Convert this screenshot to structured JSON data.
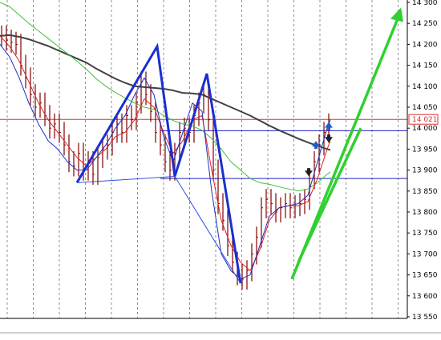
{
  "chart_data": {
    "type": "line",
    "title": "",
    "xlabel": "",
    "ylabel": "",
    "ylim": [
      13550,
      14300
    ],
    "y_ticks": [
      13550,
      13600,
      13650,
      13700,
      13750,
      13800,
      13850,
      13900,
      13950,
      14000,
      14050,
      14100,
      14150,
      14200,
      14250,
      14300
    ],
    "y_tick_labels": [
      "13 550",
      "13 600",
      "13 650",
      "13 700",
      "13 750",
      "13 800",
      "13 850",
      "13 900",
      "13 950",
      "14 000",
      "14 050",
      "14 100",
      "14 150",
      "14 200",
      "14 250",
      "14 300"
    ],
    "grid": {
      "vertical": true,
      "horizontal": false
    },
    "current_price": {
      "value": 14021,
      "label": "14 021",
      "color": "#e03030"
    },
    "horizontal_levels": [
      {
        "value": 14021,
        "color": "#e03030"
      },
      {
        "value": 13994,
        "color": "#2020c0"
      },
      {
        "value": 13880,
        "color": "#2020c0"
      }
    ],
    "series": [
      {
        "color": "#404040",
        "x": [
          0,
          12,
          24,
          36,
          48,
          60,
          72,
          84,
          96,
          108,
          120,
          132,
          144,
          156,
          168,
          180,
          192,
          204,
          216,
          228,
          240,
          252,
          264,
          276,
          288,
          300,
          312,
          324,
          336,
          348,
          360,
          372,
          384,
          396,
          408,
          412
        ],
        "values": [
          14220,
          14222,
          14218,
          14212,
          14204,
          14196,
          14186,
          14176,
          14166,
          14156,
          14142,
          14130,
          14118,
          14108,
          14100,
          14098,
          14096,
          14094,
          14090,
          14084,
          14083,
          14080,
          14070,
          14060,
          14050,
          14040,
          14030,
          14018,
          14006,
          13995,
          13985,
          13975,
          13966,
          13958,
          13950,
          13948
        ]
      },
      {
        "color": "#40c040",
        "x": [
          0,
          12,
          24,
          36,
          48,
          60,
          72,
          84,
          96,
          108,
          120,
          132,
          144,
          156,
          168,
          180,
          192,
          204,
          216,
          228,
          240,
          252,
          264,
          276,
          288,
          300,
          312,
          324,
          336,
          348,
          360,
          372,
          384,
          396,
          408,
          412
        ],
        "values": [
          14300,
          14290,
          14270,
          14250,
          14232,
          14214,
          14196,
          14178,
          14160,
          14140,
          14118,
          14100,
          14085,
          14072,
          14060,
          14050,
          14045,
          14030,
          14018,
          14010,
          14005,
          13995,
          13975,
          13950,
          13920,
          13900,
          13880,
          13870,
          13866,
          13860,
          13855,
          13850,
          13855,
          13870,
          13890,
          13895
        ]
      },
      {
        "color": "#e02020",
        "x": [
          0,
          12,
          24,
          36,
          48,
          60,
          72,
          84,
          96,
          108,
          120,
          132,
          144,
          156,
          168,
          180,
          192,
          204,
          216,
          228,
          240,
          252,
          264,
          276,
          288,
          300,
          312,
          324,
          336,
          348,
          360,
          372,
          384,
          396,
          408,
          412
        ],
        "values": [
          14220,
          14195,
          14160,
          14110,
          14060,
          14020,
          13990,
          13960,
          13930,
          13910,
          13930,
          13950,
          13980,
          13990,
          14020,
          14070,
          14050,
          13990,
          13940,
          13970,
          14020,
          14030,
          13900,
          13780,
          13720,
          13680,
          13660,
          13710,
          13780,
          13810,
          13815,
          13815,
          13825,
          13880,
          13950,
          13970
        ]
      },
      {
        "color": "#2030c0",
        "x": [
          0,
          12,
          24,
          36,
          48,
          60,
          72,
          84,
          96,
          108,
          120,
          132,
          144,
          156,
          168,
          180,
          192,
          204,
          216,
          228,
          240,
          252,
          264,
          276,
          288,
          300,
          312,
          324,
          336,
          348,
          360,
          372,
          384,
          396,
          408,
          412
        ],
        "values": [
          14200,
          14170,
          14120,
          14060,
          14010,
          13970,
          13950,
          13920,
          13900,
          13900,
          13930,
          13960,
          14000,
          14030,
          14080,
          14120,
          14080,
          13980,
          13920,
          13990,
          14060,
          14040,
          13850,
          13700,
          13660,
          13640,
          13650,
          13720,
          13790,
          13810,
          13815,
          13820,
          13840,
          13920,
          14000,
          14020
        ]
      }
    ],
    "price_bars": {
      "color": "#800000",
      "x": [
        0,
        6,
        12,
        18,
        24,
        30,
        36,
        42,
        48,
        54,
        60,
        66,
        72,
        78,
        84,
        90,
        96,
        102,
        108,
        114,
        120,
        126,
        132,
        138,
        144,
        150,
        156,
        162,
        168,
        174,
        180,
        186,
        192,
        198,
        204,
        210,
        216,
        222,
        228,
        234,
        240,
        246,
        252,
        258,
        264,
        270,
        276,
        282,
        288,
        294,
        300,
        306,
        312,
        318,
        324,
        330,
        336,
        342,
        348,
        354,
        360,
        366,
        372,
        378,
        384,
        390,
        396,
        402,
        408
      ],
      "values": [
        14220,
        14210,
        14205,
        14200,
        14150,
        14120,
        14080,
        14050,
        14060,
        14030,
        14000,
        14010,
        13990,
        13960,
        13920,
        13910,
        13940,
        13900,
        13920,
        13890,
        13930,
        13950,
        13960,
        13990,
        14010,
        13990,
        14030,
        14020,
        14060,
        14110,
        14080,
        14040,
        13990,
        13960,
        13920,
        13900,
        13940,
        13990,
        14000,
        13990,
        14030,
        14060,
        14080,
        14020,
        13900,
        13820,
        13780,
        13720,
        13680,
        13650,
        13640,
        13660,
        13700,
        13740,
        13810,
        13830,
        13820,
        13800,
        13810,
        13820,
        13810,
        13815,
        13820,
        13830,
        13880,
        13920,
        13960,
        13990,
        14010
      ]
    },
    "drawn_lines": [
      {
        "color": "#1a2fd0",
        "points": [
          [
            96,
            13870
          ],
          [
            196,
            14195
          ],
          [
            218,
            13885
          ],
          [
            258,
            14130
          ],
          [
            300,
            13630
          ]
        ]
      },
      {
        "color": "#3050e0",
        "thin": true,
        "points": [
          [
            96,
            13870
          ],
          [
            218,
            13885
          ],
          [
            300,
            13630
          ]
        ]
      },
      {
        "color": "#30d030",
        "points": [
          [
            364,
            13640
          ],
          [
            500,
            14280
          ]
        ]
      },
      {
        "color": "#30d030",
        "points": [
          [
            372,
            13680
          ],
          [
            450,
            14000
          ]
        ]
      }
    ],
    "markers": [
      {
        "type": "arrow-up",
        "x": 394,
        "value": 13960,
        "color": "#1a5fd0"
      },
      {
        "type": "arrow-up",
        "x": 410,
        "value": 14005,
        "color": "#1a5fd0"
      },
      {
        "type": "arrow-down",
        "x": 385,
        "value": 13895,
        "color": "#202020"
      },
      {
        "type": "arrow-down",
        "x": 410,
        "value": 13975,
        "color": "#202020"
      }
    ]
  }
}
